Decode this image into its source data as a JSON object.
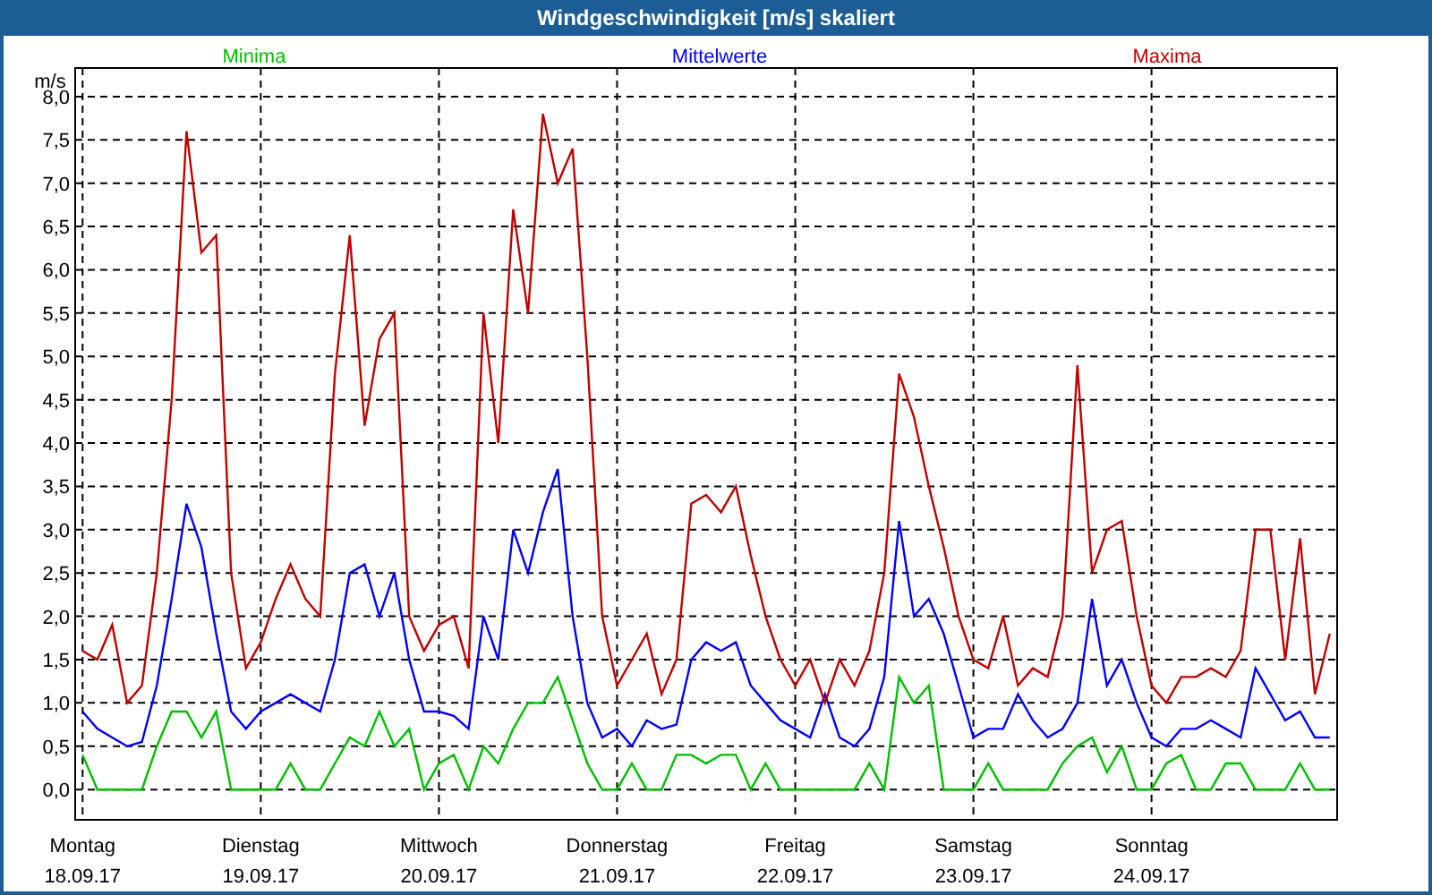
{
  "window": {
    "title": "Windgeschwindigkeit [m/s] skaliert"
  },
  "chart": {
    "dates": [
      "18.09.17",
      "19.09.17",
      "20.09.17",
      "21.09.17",
      "22.09.17",
      "23.09.17",
      "24.09.17"
    ],
    "chart_data": {
      "type": "line",
      "ylabel": "m/s",
      "categories": [
        "Montag",
        null,
        null,
        null,
        null,
        null,
        null,
        null,
        null,
        null,
        null,
        null,
        "Dienstag",
        null,
        null,
        null,
        null,
        null,
        null,
        null,
        null,
        null,
        null,
        null,
        "Mittwoch",
        null,
        null,
        null,
        null,
        null,
        null,
        null,
        null,
        null,
        null,
        null,
        "Donnerstag",
        null,
        null,
        null,
        null,
        null,
        null,
        null,
        null,
        null,
        null,
        null,
        "Freitag",
        null,
        null,
        null,
        null,
        null,
        null,
        null,
        null,
        null,
        null,
        null,
        "Samstag",
        null,
        null,
        null,
        null,
        null,
        null,
        null,
        null,
        null,
        null,
        null,
        "Sonntag",
        null,
        null,
        null,
        null,
        null,
        null,
        null,
        null,
        null,
        null,
        null,
        null
      ],
      "ylim": [
        -0.35,
        8.33
      ],
      "grid": true,
      "yticks": [
        {
          "value": 0,
          "label": "0,0"
        },
        {
          "value": 0.5,
          "label": "0,5"
        },
        {
          "value": 1,
          "label": "1,0"
        },
        {
          "value": 1.5,
          "label": "1,5"
        },
        {
          "value": 2,
          "label": "2,0"
        },
        {
          "value": 2.5,
          "label": "2,5"
        },
        {
          "value": 3,
          "label": "3,0"
        },
        {
          "value": 3.5,
          "label": "3,5"
        },
        {
          "value": 4,
          "label": "4,0"
        },
        {
          "value": 4.5,
          "label": "4,5"
        },
        {
          "value": 5,
          "label": "5,0"
        },
        {
          "value": 5.5,
          "label": "5,5"
        },
        {
          "value": 6,
          "label": "6,0"
        },
        {
          "value": 6.5,
          "label": "6,5"
        },
        {
          "value": 7,
          "label": "7,0"
        },
        {
          "value": 7.5,
          "label": "7,5"
        },
        {
          "value": 8,
          "label": "8,0"
        }
      ],
      "series": [
        {
          "name": "Minima",
          "color": "#00c000",
          "values": [
            0.4,
            0,
            0,
            0,
            0,
            0.5,
            0.9,
            0.9,
            0.6,
            0.9,
            0,
            0,
            0,
            0,
            0.3,
            0,
            0,
            0.3,
            0.6,
            0.5,
            0.9,
            0.5,
            0.7,
            0,
            0.3,
            0.4,
            0,
            0.5,
            0.3,
            0.7,
            1.0,
            1.0,
            1.3,
            0.8,
            0.3,
            0,
            0,
            0.3,
            0,
            0,
            0.4,
            0.4,
            0.3,
            0.4,
            0.4,
            0,
            0.3,
            0,
            0,
            0,
            0,
            0,
            0,
            0.3,
            0,
            1.3,
            1.0,
            1.2,
            0,
            0,
            0,
            0.3,
            0,
            0,
            0,
            0,
            0.3,
            0.5,
            0.6,
            0.2,
            0.5,
            0,
            0,
            0.3,
            0.4,
            0,
            0,
            0.3,
            0.3,
            0,
            0,
            0,
            0.3,
            0,
            0
          ]
        },
        {
          "name": "Mittelwerte",
          "color": "#0000ff",
          "values": [
            0.9,
            0.7,
            0.6,
            0.5,
            0.55,
            1.2,
            2.2,
            3.3,
            2.8,
            1.8,
            0.9,
            0.7,
            0.9,
            1.0,
            1.1,
            1.0,
            0.9,
            1.5,
            2.5,
            2.6,
            2.0,
            2.5,
            1.5,
            0.9,
            0.9,
            0.85,
            0.7,
            2.0,
            1.5,
            3.0,
            2.5,
            3.2,
            3.7,
            2.0,
            1.0,
            0.6,
            0.7,
            0.5,
            0.8,
            0.7,
            0.75,
            1.5,
            1.7,
            1.6,
            1.7,
            1.2,
            1.0,
            0.8,
            0.7,
            0.6,
            1.1,
            0.6,
            0.5,
            0.7,
            1.3,
            3.1,
            2.0,
            2.2,
            1.8,
            1.2,
            0.6,
            0.7,
            0.7,
            1.1,
            0.8,
            0.6,
            0.7,
            1.0,
            2.2,
            1.2,
            1.5,
            1.0,
            0.6,
            0.5,
            0.7,
            0.7,
            0.8,
            0.7,
            0.6,
            1.4,
            1.1,
            0.8,
            0.9,
            0.6,
            0.6
          ]
        },
        {
          "name": "Maxima",
          "color": "#c00000",
          "values": [
            1.6,
            1.5,
            1.9,
            1.0,
            1.2,
            2.5,
            4.5,
            7.6,
            6.2,
            6.4,
            2.5,
            1.4,
            1.7,
            2.2,
            2.6,
            2.2,
            2.0,
            4.8,
            6.4,
            4.2,
            5.2,
            5.5,
            2.0,
            1.6,
            1.9,
            2.0,
            1.4,
            5.5,
            4.0,
            6.7,
            5.5,
            7.8,
            7.0,
            7.4,
            5.0,
            2.0,
            1.2,
            1.5,
            1.8,
            1.1,
            1.5,
            3.3,
            3.4,
            3.2,
            3.5,
            2.7,
            2.0,
            1.5,
            1.2,
            1.5,
            1.0,
            1.5,
            1.2,
            1.6,
            2.5,
            4.8,
            4.3,
            3.5,
            2.8,
            2.0,
            1.5,
            1.4,
            2.0,
            1.2,
            1.4,
            1.3,
            2.0,
            4.9,
            2.5,
            3.0,
            3.1,
            2.0,
            1.2,
            1.0,
            1.3,
            1.3,
            1.4,
            1.3,
            1.6,
            3.0,
            3.0,
            1.5,
            2.9,
            1.1,
            1.8
          ]
        }
      ]
    }
  }
}
